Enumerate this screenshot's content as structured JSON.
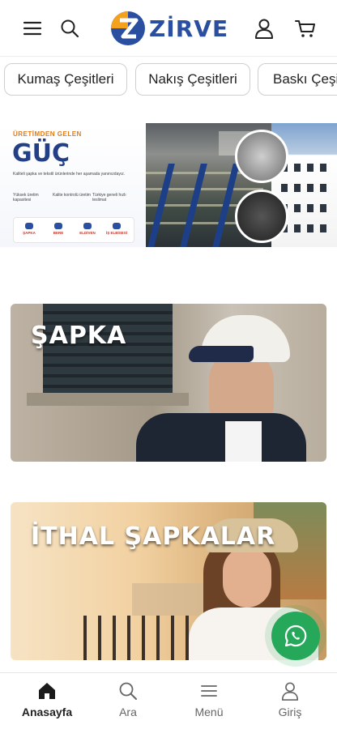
{
  "header": {
    "brand": "ZİRVE",
    "icons": [
      "menu-icon",
      "search-icon",
      "user-icon",
      "cart-icon"
    ],
    "brand_color": "#2a4fa0",
    "accent_color": "#f4a11d"
  },
  "categories": [
    {
      "label": "Kumaş Çeşitleri"
    },
    {
      "label": "Nakış Çeşitleri"
    },
    {
      "label": "Baskı Çeşit"
    }
  ],
  "banner": {
    "kicker": "ÜRETİMDEN GELEN",
    "headline": "GÜÇ",
    "text": "Kaliteli şapka ve tekstil ürünlerinde her aşamada yanınızdayız.",
    "features": [
      "Yüksek üretim kapasitesi",
      "Kalite kontrolü üretim",
      "Türkiye geneli hızlı teslimat"
    ],
    "strip": [
      "ŞAPKA",
      "BERE",
      "ELDİVEN",
      "İŞ ELBİSESİ"
    ]
  },
  "cards": [
    {
      "title": "ŞAPKA"
    },
    {
      "title": "İTHAL ŞAPKALAR"
    }
  ],
  "whatsapp": {
    "icon": "whatsapp-icon",
    "color": "#25a85a"
  },
  "bottom_nav": [
    {
      "label": "Anasayfa",
      "icon": "home-icon",
      "active": true
    },
    {
      "label": "Ara",
      "icon": "search-icon",
      "active": false
    },
    {
      "label": "Menü",
      "icon": "menu-icon",
      "active": false
    },
    {
      "label": "Giriş",
      "icon": "user-icon",
      "active": false
    }
  ]
}
